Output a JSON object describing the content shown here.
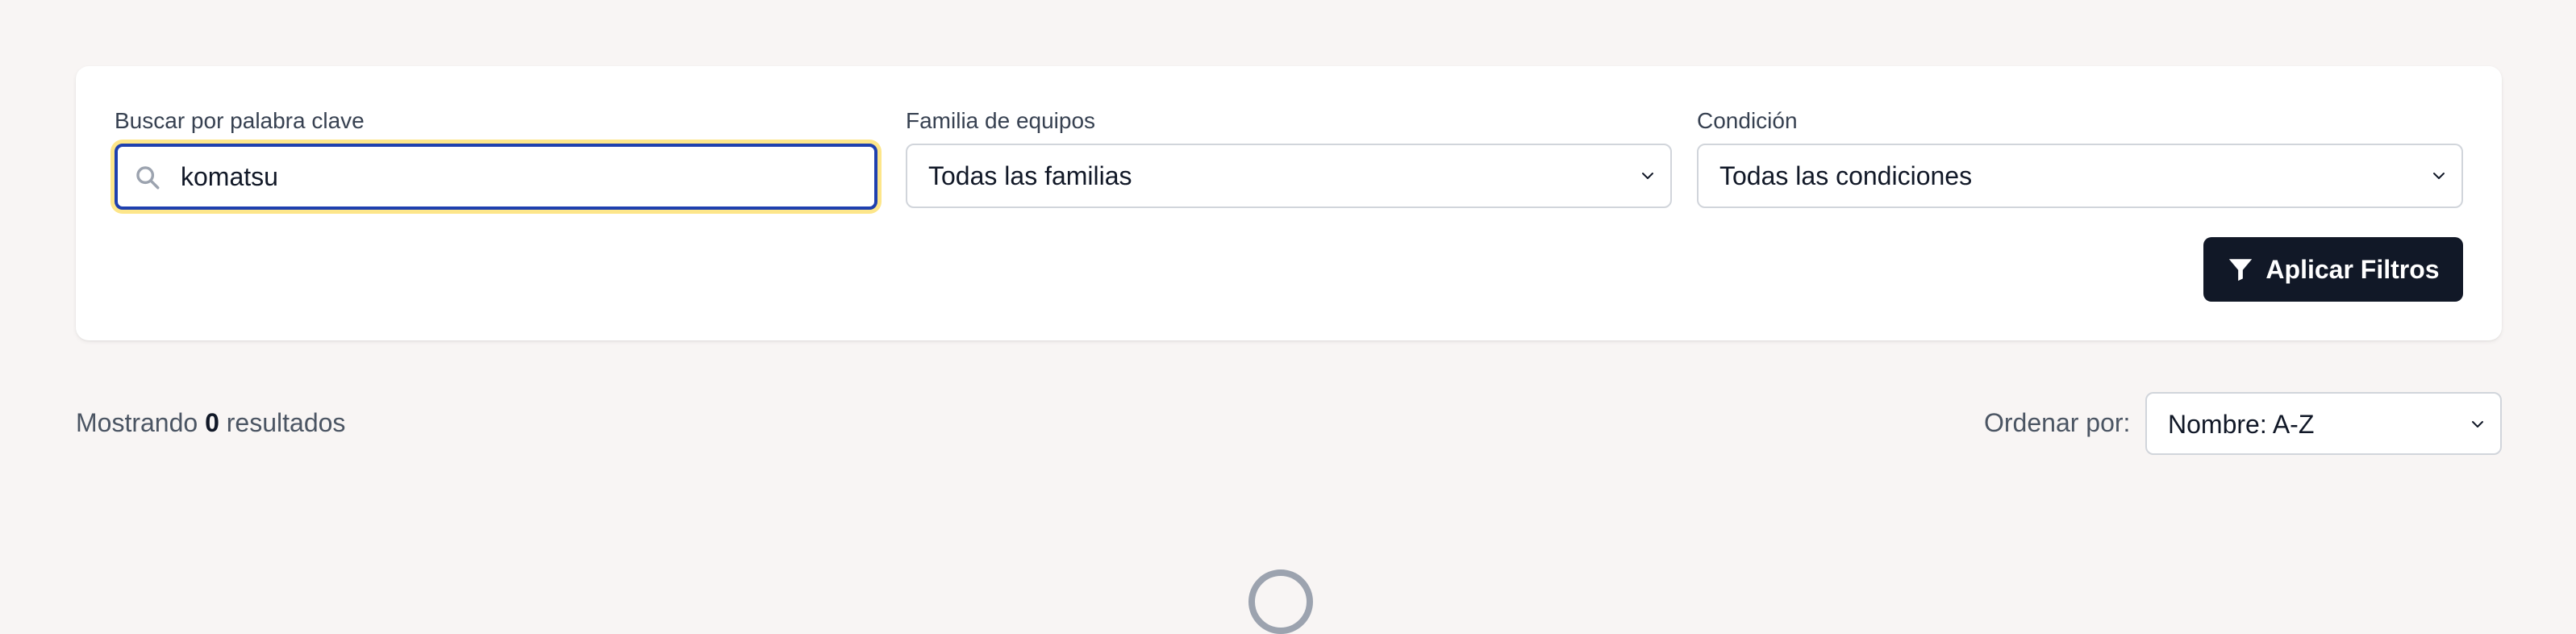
{
  "filters": {
    "keyword": {
      "label": "Buscar por palabra clave",
      "value": "komatsu",
      "icon": "search-icon"
    },
    "family": {
      "label": "Familia de equipos",
      "selected": "Todas las familias"
    },
    "condition": {
      "label": "Condición",
      "selected": "Todas las condiciones"
    },
    "apply_button": {
      "label": "Aplicar Filtros",
      "icon": "filter-icon"
    }
  },
  "results": {
    "prefix": "Mostrando",
    "count": "0",
    "suffix": "resultados"
  },
  "sort": {
    "label": "Ordenar por:",
    "selected": "Nombre: A-Z"
  },
  "colors": {
    "page_background": "#f8f5f4",
    "primary_button": "#111827",
    "focus_border": "#1e40af",
    "focus_ring": "#fde68a"
  }
}
